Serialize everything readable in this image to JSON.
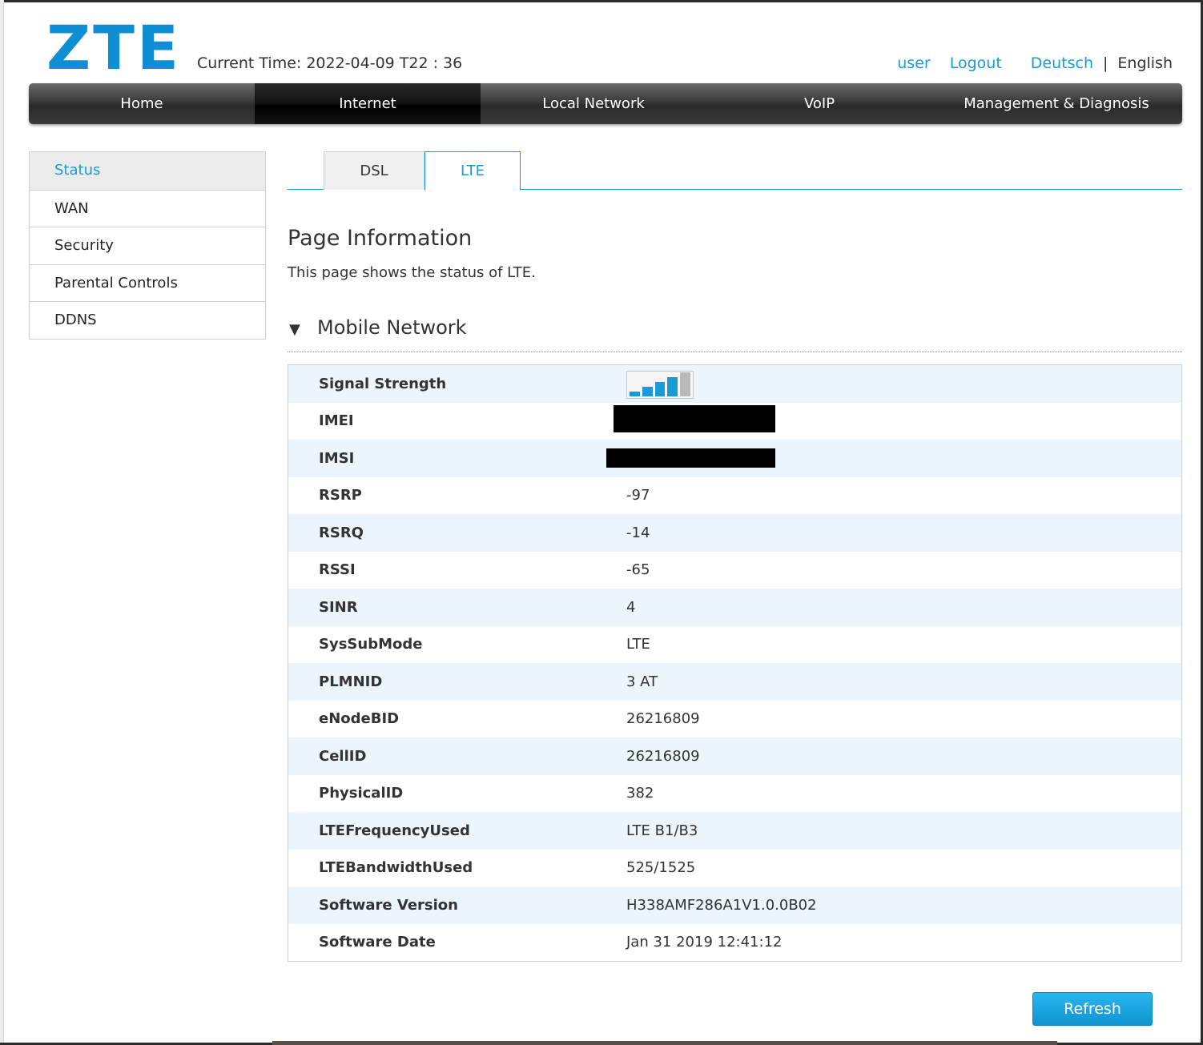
{
  "brand": {
    "logo_text": "ZTE",
    "accent_color": "#1a9ad6"
  },
  "header": {
    "current_time": "Current Time: 2022-04-09 T22 : 36",
    "user_link": "user",
    "logout_link": "Logout",
    "lang_de": "Deutsch",
    "lang_sep": "|",
    "lang_en": "English"
  },
  "nav": {
    "items": [
      {
        "label": "Home"
      },
      {
        "label": "Internet"
      },
      {
        "label": "Local Network"
      },
      {
        "label": "VoIP"
      },
      {
        "label": "Management & Diagnosis"
      }
    ],
    "active": "Internet"
  },
  "sidebar": {
    "items": [
      {
        "label": "Status"
      },
      {
        "label": "WAN"
      },
      {
        "label": "Security"
      },
      {
        "label": "Parental Controls"
      },
      {
        "label": "DDNS"
      }
    ],
    "active": "Status"
  },
  "tabs": {
    "items": [
      {
        "label": "DSL"
      },
      {
        "label": "LTE"
      }
    ],
    "active": "LTE"
  },
  "page": {
    "title": "Page Information",
    "description": "This page shows the status of LTE."
  },
  "section": {
    "title": "Mobile Network",
    "expanded": true
  },
  "signal": {
    "bars_on": 4,
    "bars_total": 5,
    "icon": "signal-strength-icon"
  },
  "rows": [
    {
      "key": "Signal Strength",
      "value": ""
    },
    {
      "key": "IMEI",
      "value": ""
    },
    {
      "key": "IMSI",
      "value": ""
    },
    {
      "key": "RSRP",
      "value": "-97"
    },
    {
      "key": "RSRQ",
      "value": "-14"
    },
    {
      "key": "RSSI",
      "value": "-65"
    },
    {
      "key": "SINR",
      "value": "4"
    },
    {
      "key": "SysSubMode",
      "value": "LTE"
    },
    {
      "key": "PLMNID",
      "value": "3 AT"
    },
    {
      "key": "eNodeBID",
      "value": "26216809"
    },
    {
      "key": "CellID",
      "value": "26216809"
    },
    {
      "key": "PhysicalID",
      "value": "382"
    },
    {
      "key": "LTEFrequencyUsed",
      "value": "LTE B1/B3"
    },
    {
      "key": "LTEBandwidthUsed",
      "value": "525/1525"
    },
    {
      "key": "Software Version",
      "value": "H338AMF286A1V1.0.0B02"
    },
    {
      "key": "Software Date",
      "value": "Jan 31 2019 12:41:12"
    }
  ],
  "actions": {
    "refresh_label": "Refresh"
  }
}
